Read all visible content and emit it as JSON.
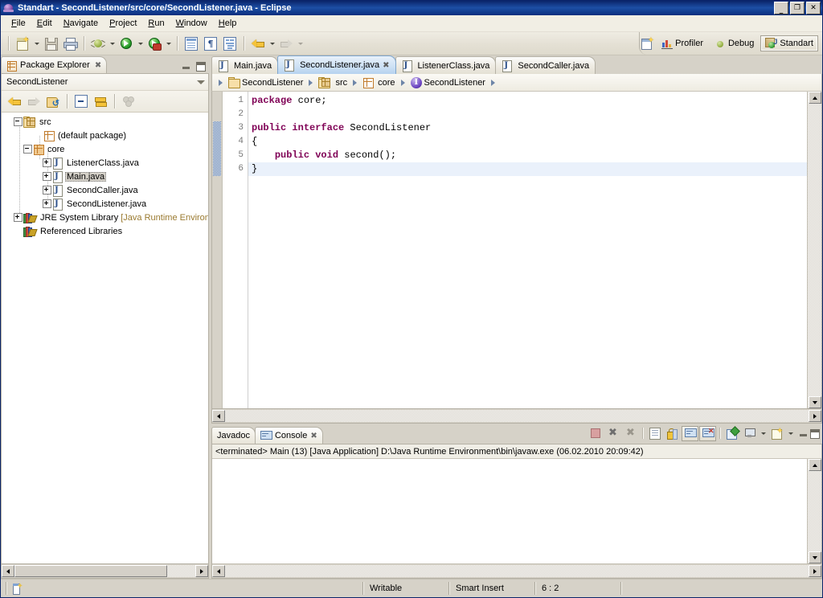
{
  "window": {
    "title": "Standart - SecondListener/src/core/SecondListener.java - Eclipse",
    "icon": "eclipse-globe-icon",
    "minimize_label": "_",
    "restore_label": "❐",
    "close_label": "✕"
  },
  "menubar": {
    "items": [
      {
        "label": "File",
        "mnemonic": "F"
      },
      {
        "label": "Edit",
        "mnemonic": "E"
      },
      {
        "label": "Navigate",
        "mnemonic": "N"
      },
      {
        "label": "Project",
        "mnemonic": "P"
      },
      {
        "label": "Run",
        "mnemonic": "R"
      },
      {
        "label": "Window",
        "mnemonic": "W"
      },
      {
        "label": "Help",
        "mnemonic": "H"
      }
    ]
  },
  "toolbar": {
    "buttons": [
      {
        "name": "new-wizard-icon",
        "tooltip": "New"
      },
      {
        "name": "save-icon",
        "tooltip": "Save"
      },
      {
        "name": "print-icon",
        "tooltip": "Print"
      },
      {
        "name": "debug-icon",
        "tooltip": "Debug"
      },
      {
        "name": "run-icon",
        "tooltip": "Run"
      },
      {
        "name": "external-tools-icon",
        "tooltip": "External Tools"
      },
      {
        "name": "open-type-icon",
        "tooltip": "Open Type"
      },
      {
        "name": "open-task-icon",
        "tooltip": "Open Task"
      },
      {
        "name": "toggle-mark-occurrences-icon",
        "tooltip": "Toggle Mark Occurrences"
      },
      {
        "name": "back-icon",
        "tooltip": "Back"
      },
      {
        "name": "forward-icon",
        "tooltip": "Forward"
      }
    ]
  },
  "perspectives": {
    "open_perspective_tooltip": "Open Perspective",
    "items": [
      {
        "label": "Profiler",
        "icon": "profiler-icon",
        "active": false
      },
      {
        "label": "Debug",
        "icon": "debug-perspective-icon",
        "active": false
      },
      {
        "label": "Standart",
        "icon": "standart-perspective-icon",
        "active": true
      }
    ]
  },
  "package_explorer": {
    "tab_label": "Package Explorer",
    "tab_icon": "package-explorer-icon",
    "close_label": "✖",
    "minimize_tooltip": "Minimize",
    "maximize_tooltip": "Maximize",
    "title": "SecondListener",
    "menu_tooltip": "View Menu",
    "toolbar": [
      {
        "name": "back-icon",
        "tooltip": "Back"
      },
      {
        "name": "forward-icon",
        "tooltip": "Forward"
      },
      {
        "name": "refresh-icon",
        "tooltip": "Collapse To"
      },
      {
        "name": "collapse-all-icon",
        "tooltip": "Collapse All"
      },
      {
        "name": "link-with-editor-icon",
        "tooltip": "Link with Editor"
      },
      {
        "name": "view-menu-dots-icon",
        "tooltip": "Menu"
      }
    ],
    "tree": [
      {
        "label": "src",
        "icon": "source-folder-icon",
        "indent": 0,
        "twisty": "minus",
        "selected": false
      },
      {
        "label": "(default package)",
        "icon": "package-icon",
        "indent": 1,
        "twisty": "none",
        "selected": false
      },
      {
        "label": "core",
        "icon": "package-filled-icon",
        "indent": 1,
        "twisty": "minus",
        "selected": false
      },
      {
        "label": "ListenerClass.java",
        "icon": "java-file-icon",
        "indent": 2,
        "twisty": "plus",
        "selected": false
      },
      {
        "label": "Main.java",
        "icon": "java-file-icon",
        "indent": 2,
        "twisty": "plus",
        "selected": true
      },
      {
        "label": "SecondCaller.java",
        "icon": "java-file-icon",
        "indent": 2,
        "twisty": "plus",
        "selected": false
      },
      {
        "label": "SecondListener.java",
        "icon": "java-file-icon",
        "indent": 2,
        "twisty": "plus",
        "selected": false
      },
      {
        "label": "JRE System Library ",
        "suffix": "[Java Runtime Environm",
        "icon": "jre-library-icon",
        "indent": 0,
        "twisty": "plus",
        "selected": false
      },
      {
        "label": "Referenced Libraries",
        "icon": "jre-library-icon",
        "indent": 0,
        "twisty": "none",
        "selected": false
      }
    ]
  },
  "editor": {
    "tabs": [
      {
        "label": "Main.java",
        "icon": "java-file-icon",
        "active": false,
        "closable": false
      },
      {
        "label": "SecondListener.java",
        "icon": "java-file-icon",
        "active": true,
        "closable": true,
        "close_label": "✖"
      },
      {
        "label": "ListenerClass.java",
        "icon": "java-file-icon",
        "active": false,
        "closable": false
      },
      {
        "label": "SecondCaller.java",
        "icon": "java-file-icon",
        "active": false,
        "closable": false
      }
    ],
    "breadcrumb": [
      {
        "label": "SecondListener",
        "icon": "project-icon"
      },
      {
        "label": "src",
        "icon": "source-folder-icon"
      },
      {
        "label": "core",
        "icon": "package-icon"
      },
      {
        "label": "SecondListener",
        "icon": "interface-icon"
      }
    ],
    "line_numbers": [
      "1",
      "2",
      "3",
      "4",
      "5",
      "6"
    ],
    "lines": [
      {
        "n": 1,
        "tokens": [
          {
            "t": "package",
            "k": true
          },
          {
            "t": " core;",
            "k": false
          }
        ],
        "current": false,
        "changed": false
      },
      {
        "n": 2,
        "tokens": [
          {
            "t": "",
            "k": false
          }
        ],
        "current": false,
        "changed": false
      },
      {
        "n": 3,
        "tokens": [
          {
            "t": "public",
            "k": true
          },
          {
            "t": " ",
            "k": false
          },
          {
            "t": "interface",
            "k": true
          },
          {
            "t": " SecondListener",
            "k": false
          }
        ],
        "current": false,
        "changed": true
      },
      {
        "n": 4,
        "tokens": [
          {
            "t": "{",
            "k": false
          }
        ],
        "current": false,
        "changed": true
      },
      {
        "n": 5,
        "tokens": [
          {
            "t": "    ",
            "k": false
          },
          {
            "t": "public",
            "k": true
          },
          {
            "t": " ",
            "k": false
          },
          {
            "t": "void",
            "k": true
          },
          {
            "t": " second();",
            "k": false
          }
        ],
        "current": false,
        "changed": true
      },
      {
        "n": 6,
        "tokens": [
          {
            "t": "}",
            "k": false
          }
        ],
        "current": true,
        "changed": true
      }
    ]
  },
  "console_panel": {
    "tabs": [
      {
        "label": "Javadoc",
        "icon": "",
        "active": false,
        "closable": false
      },
      {
        "label": "Console",
        "icon": "console-icon",
        "active": true,
        "closable": true,
        "close_label": "✖"
      }
    ],
    "toolbar": [
      {
        "name": "terminate-icon",
        "tooltip": "Terminate",
        "toggled": false
      },
      {
        "name": "remove-launch-icon",
        "tooltip": "Remove Launch",
        "toggled": false
      },
      {
        "name": "remove-all-terminated-icon",
        "tooltip": "Remove All Terminated Launches",
        "toggled": false
      },
      {
        "name": "clear-console-icon",
        "tooltip": "Clear Console",
        "toggled": false
      },
      {
        "name": "scroll-lock-icon",
        "tooltip": "Scroll Lock",
        "toggled": false
      },
      {
        "name": "show-console-on-output-icon",
        "tooltip": "Show Console When Standard Out Changes",
        "toggled": true
      },
      {
        "name": "show-console-on-error-icon",
        "tooltip": "Show Console When Standard Error Changes",
        "toggled": true
      },
      {
        "name": "pin-console-icon",
        "tooltip": "Pin Console",
        "toggled": false
      },
      {
        "name": "display-selected-console-icon",
        "tooltip": "Display Selected Console",
        "toggled": false
      },
      {
        "name": "open-console-icon",
        "tooltip": "Open Console",
        "toggled": false
      }
    ],
    "minimize_tooltip": "Minimize",
    "maximize_tooltip": "Maximize",
    "header_text": "<terminated> Main (13) [Java Application] D:\\Java Runtime Environment\\bin\\javaw.exe (06.02.2010 20:09:42)",
    "output_text": ""
  },
  "statusbar": {
    "mode_icon": "smart-insert-icon",
    "writable": "Writable",
    "insert_mode": "Smart Insert",
    "position": "6 : 2"
  },
  "colors": {
    "titlebar_start": "#0a246a",
    "titlebar_end": "#1d4fa5",
    "keyword": "#7f0055",
    "active_tab": "#b6d2ef",
    "current_line": "#eaf1fb",
    "chrome": "#d6d2c8"
  }
}
